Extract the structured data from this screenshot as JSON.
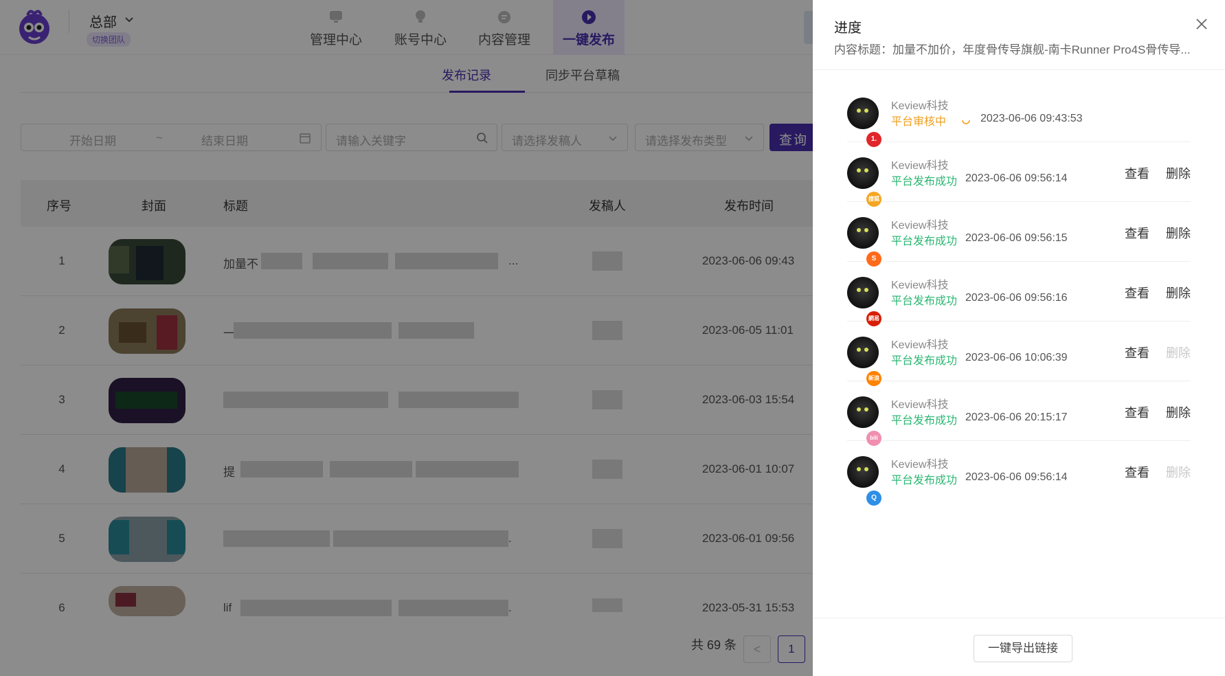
{
  "header": {
    "org_name": "总部",
    "switch_team": "切换团队",
    "nav": [
      {
        "label": "管理中心",
        "icon": "monitor-icon"
      },
      {
        "label": "账号中心",
        "icon": "lightbulb-icon"
      },
      {
        "label": "内容管理",
        "icon": "content-icon"
      },
      {
        "label": "一键发布",
        "icon": "play-publish-icon",
        "active": true
      }
    ]
  },
  "subtabs": [
    {
      "label": "发布记录",
      "active": true
    },
    {
      "label": "同步平台草稿",
      "active": false
    }
  ],
  "filters": {
    "start_date_placeholder": "开始日期",
    "separator": "~",
    "end_date_placeholder": "结束日期",
    "keyword_placeholder": "请输入关键字",
    "author_placeholder": "请选择发稿人",
    "type_placeholder": "请选择发布类型",
    "query_label": "查询"
  },
  "table": {
    "headers": [
      "序号",
      "封面",
      "标题",
      "发稿人",
      "发布时间"
    ],
    "rows": [
      {
        "index": "1",
        "title_visible": "加量不",
        "title_tail": "...",
        "time": "2023-06-06 09:43"
      },
      {
        "index": "2",
        "title_visible": "一",
        "title_tail": "",
        "time": "2023-06-05 11:01"
      },
      {
        "index": "3",
        "title_visible": "",
        "title_tail": "",
        "time": "2023-06-03 15:54"
      },
      {
        "index": "4",
        "title_visible": "提",
        "title_tail": "",
        "time": "2023-06-01 10:07"
      },
      {
        "index": "5",
        "title_visible": "",
        "title_tail": ".",
        "time": "2023-06-01 09:56"
      },
      {
        "index": "6",
        "title_visible": "lif",
        "title_tail": ".",
        "time": "2023-05-31 15:53"
      }
    ]
  },
  "pagination": {
    "total": "共 69 条",
    "prev": "<",
    "current": "1"
  },
  "drawer": {
    "title": "进度",
    "subtitle_label": "内容标题：",
    "subtitle_value": "加量不加价，年度骨传导旗舰-南卡Runner Pro4S骨传导...",
    "view_label": "查看",
    "delete_label": "删除",
    "export_label": "一键导出链接",
    "items": [
      {
        "account": "Keview科技",
        "status": "平台审核中",
        "status_type": "pending",
        "time": "2023-06-06 09:43:53",
        "platform_badge": "1.",
        "badge_color": "#e0262b",
        "has_actions": false,
        "delete_enabled": false
      },
      {
        "account": "Keview科技",
        "status": "平台发布成功",
        "status_type": "ok",
        "time": "2023-06-06 09:56:14",
        "platform_badge": "搜狐",
        "badge_color": "#f5a623",
        "has_actions": true,
        "delete_enabled": true
      },
      {
        "account": "Keview科技",
        "status": "平台发布成功",
        "status_type": "ok",
        "time": "2023-06-06 09:56:15",
        "platform_badge": "S",
        "badge_color": "#ff6a1a",
        "has_actions": true,
        "delete_enabled": true
      },
      {
        "account": "Keview科技",
        "status": "平台发布成功",
        "status_type": "ok",
        "time": "2023-06-06 09:56:16",
        "platform_badge": "網易",
        "badge_color": "#d81e06",
        "has_actions": true,
        "delete_enabled": true
      },
      {
        "account": "Keview科技",
        "status": "平台发布成功",
        "status_type": "ok",
        "time": "2023-06-06 10:06:39",
        "platform_badge": "新浪",
        "badge_color": "#ff8200",
        "has_actions": true,
        "delete_enabled": false
      },
      {
        "account": "Keview科技",
        "status": "平台发布成功",
        "status_type": "ok",
        "time": "2023-06-06 20:15:17",
        "platform_badge": "bili",
        "badge_color": "#f08fb0",
        "has_actions": true,
        "delete_enabled": true
      },
      {
        "account": "Keview科技",
        "status": "平台发布成功",
        "status_type": "ok",
        "time": "2023-06-06 09:56:14",
        "platform_badge": "Q",
        "badge_color": "#2f8fe6",
        "has_actions": true,
        "delete_enabled": false
      }
    ]
  },
  "colors": {
    "brand": "#4a2fb0",
    "success": "#2bb673",
    "pending": "#f0a020"
  }
}
